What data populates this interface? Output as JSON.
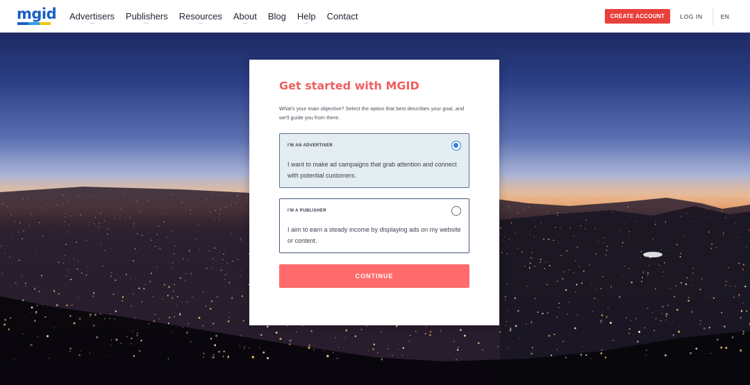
{
  "header": {
    "logo": "mgid",
    "logo_colors": [
      "#1b5fc4",
      "#2aa0e8",
      "#f5c400"
    ],
    "nav": [
      {
        "label": "Advertisers",
        "has_dropdown": true
      },
      {
        "label": "Publishers",
        "has_dropdown": true
      },
      {
        "label": "Resources",
        "has_dropdown": true
      },
      {
        "label": "About",
        "has_dropdown": true
      },
      {
        "label": "Blog",
        "has_dropdown": false
      },
      {
        "label": "Help",
        "has_dropdown": true
      },
      {
        "label": "Contact",
        "has_dropdown": false
      }
    ],
    "create_account": "CREATE ACCOUNT",
    "login": "LOG IN",
    "language": "EN"
  },
  "card": {
    "title": "Get started with MGID",
    "description": "What's your main objective? Select the option that best describes your goal, and we'll guide you from there.",
    "options": [
      {
        "title": "I'M AN ADVERTISER",
        "text": "I want to make ad campaigns that grab attention and connect with potential customers.",
        "selected": true
      },
      {
        "title": "I'M A PUBLISHER",
        "text": "I aim to earn a steady income by displaying ads on my website or content.",
        "selected": false
      }
    ],
    "continue_label": "CONTINUE"
  },
  "colors": {
    "accent": "#ef5f5f",
    "button": "#ff6b6c",
    "create_account_bg": "#e8403a",
    "radio_selected": "#2f7de1"
  }
}
